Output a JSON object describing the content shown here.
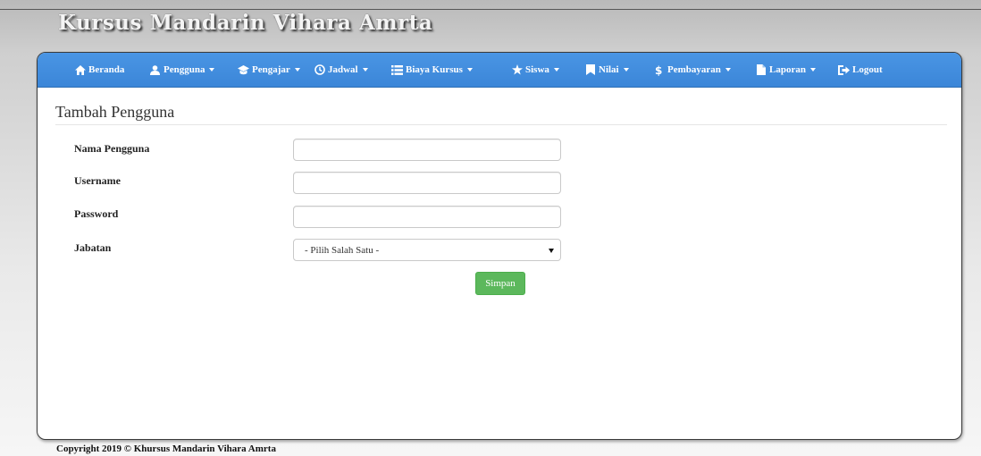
{
  "site": {
    "title": "Kursus Mandarin Vihara Amrta"
  },
  "nav": {
    "beranda": "Beranda",
    "pengguna": "Pengguna",
    "pengajar": "Pengajar",
    "jadwal": "Jadwal",
    "biaya_kursus": "Biaya Kursus",
    "siswa": "Siswa",
    "nilai": "Nilai",
    "pembayaran": "Pembayaran",
    "laporan": "Laporan",
    "logout": "Logout"
  },
  "icons": {
    "beranda": "home-icon",
    "pengguna": "user-icon",
    "pengajar": "education-icon",
    "jadwal": "clock-icon",
    "biaya_kursus": "list-icon",
    "siswa": "star-icon",
    "nilai": "bookmark-icon",
    "pembayaran": "dollar-icon",
    "laporan": "file-icon",
    "logout": "logout-icon"
  },
  "colors": {
    "navbar": "#3b86d8",
    "button_success": "#5cb85c"
  },
  "page": {
    "heading": "Tambah Pengguna"
  },
  "form": {
    "nama_pengguna": {
      "label": "Nama Pengguna",
      "value": ""
    },
    "username": {
      "label": "Username",
      "value": ""
    },
    "password": {
      "label": "Password",
      "value": ""
    },
    "jabatan": {
      "label": "Jabatan",
      "selected": "- Pilih Salah Satu -"
    },
    "submit_label": "Simpan"
  },
  "footer": {
    "copyright": "Copyright 2019 © Khursus Mandarin Vihara Amrta"
  }
}
